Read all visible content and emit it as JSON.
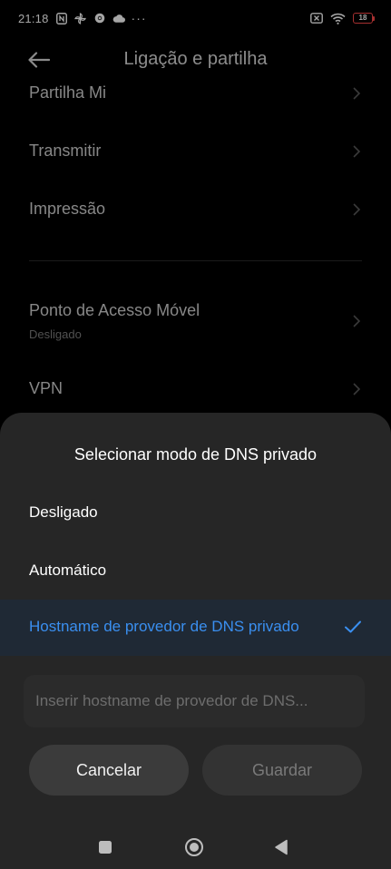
{
  "status_bar": {
    "time": "21:18",
    "more": "···",
    "battery_level": "18",
    "icons": [
      "nfc-icon",
      "pinwheel-icon",
      "chrome-icon",
      "cloud-icon",
      "alarm-off-icon",
      "wifi-icon",
      "battery-icon"
    ],
    "battery_color": "#ff4a4a"
  },
  "header": {
    "title": "Ligação e partilha"
  },
  "settings": {
    "items": [
      {
        "label": "Partilha Mi"
      },
      {
        "label": "Transmitir"
      },
      {
        "label": "Impressão"
      },
      {
        "label": "Ponto de Acesso Móvel",
        "sublabel": "Desligado"
      },
      {
        "label": "VPN"
      }
    ]
  },
  "dns_sheet": {
    "title": "Selecionar modo de DNS privado",
    "options": [
      {
        "label": "Desligado",
        "selected": false
      },
      {
        "label": "Automático",
        "selected": false
      },
      {
        "label": "Hostname de provedor de DNS privado",
        "selected": true
      }
    ],
    "hostname_input": {
      "value": "",
      "placeholder": "Inserir hostname de provedor de DNS..."
    },
    "cancel_label": "Cancelar",
    "save_label": "Guardar",
    "accent_color": "#3a8ff0"
  },
  "nav_bar": {
    "icons": [
      "square-recents-icon",
      "circle-home-icon",
      "triangle-back-icon"
    ]
  }
}
